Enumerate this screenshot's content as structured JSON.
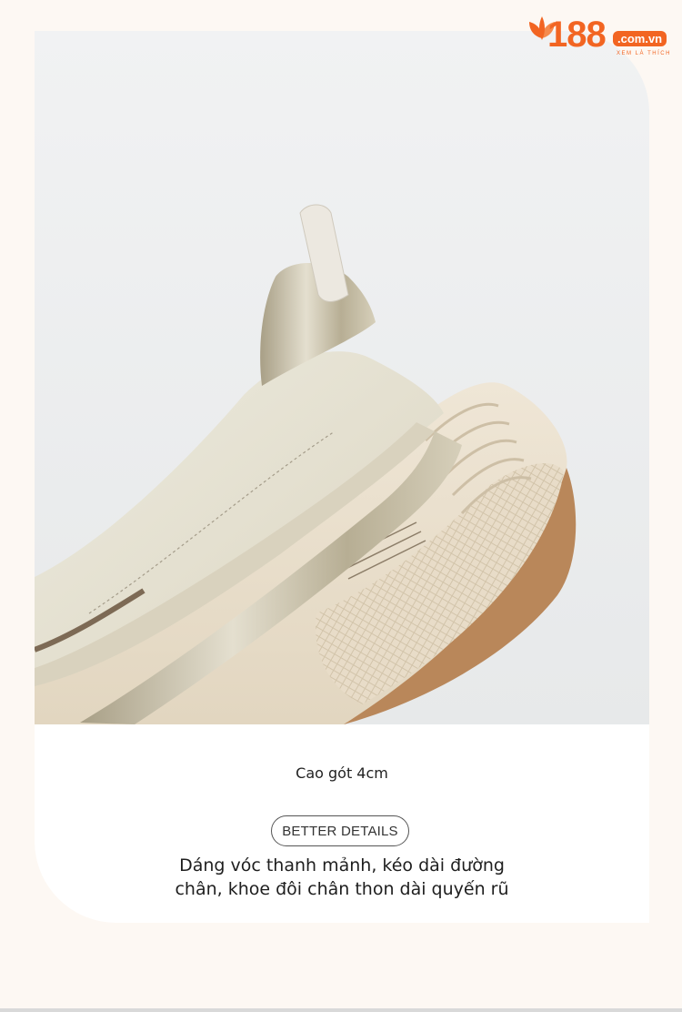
{
  "logo": {
    "number": "188",
    "domain": ".com.vn",
    "tagline": "XEM LÀ THÍCH",
    "icon": "leaf-icon",
    "color": "#f26522"
  },
  "product": {
    "image": "shoe-heel-closeup-image",
    "caption": "Cao gót 4cm",
    "badge": "BETTER DETAILS",
    "description_line1": "Dáng vóc thanh mảnh, kéo dài đường",
    "description_line2": "chân, khoe đôi chân thon dài quyến rũ"
  }
}
